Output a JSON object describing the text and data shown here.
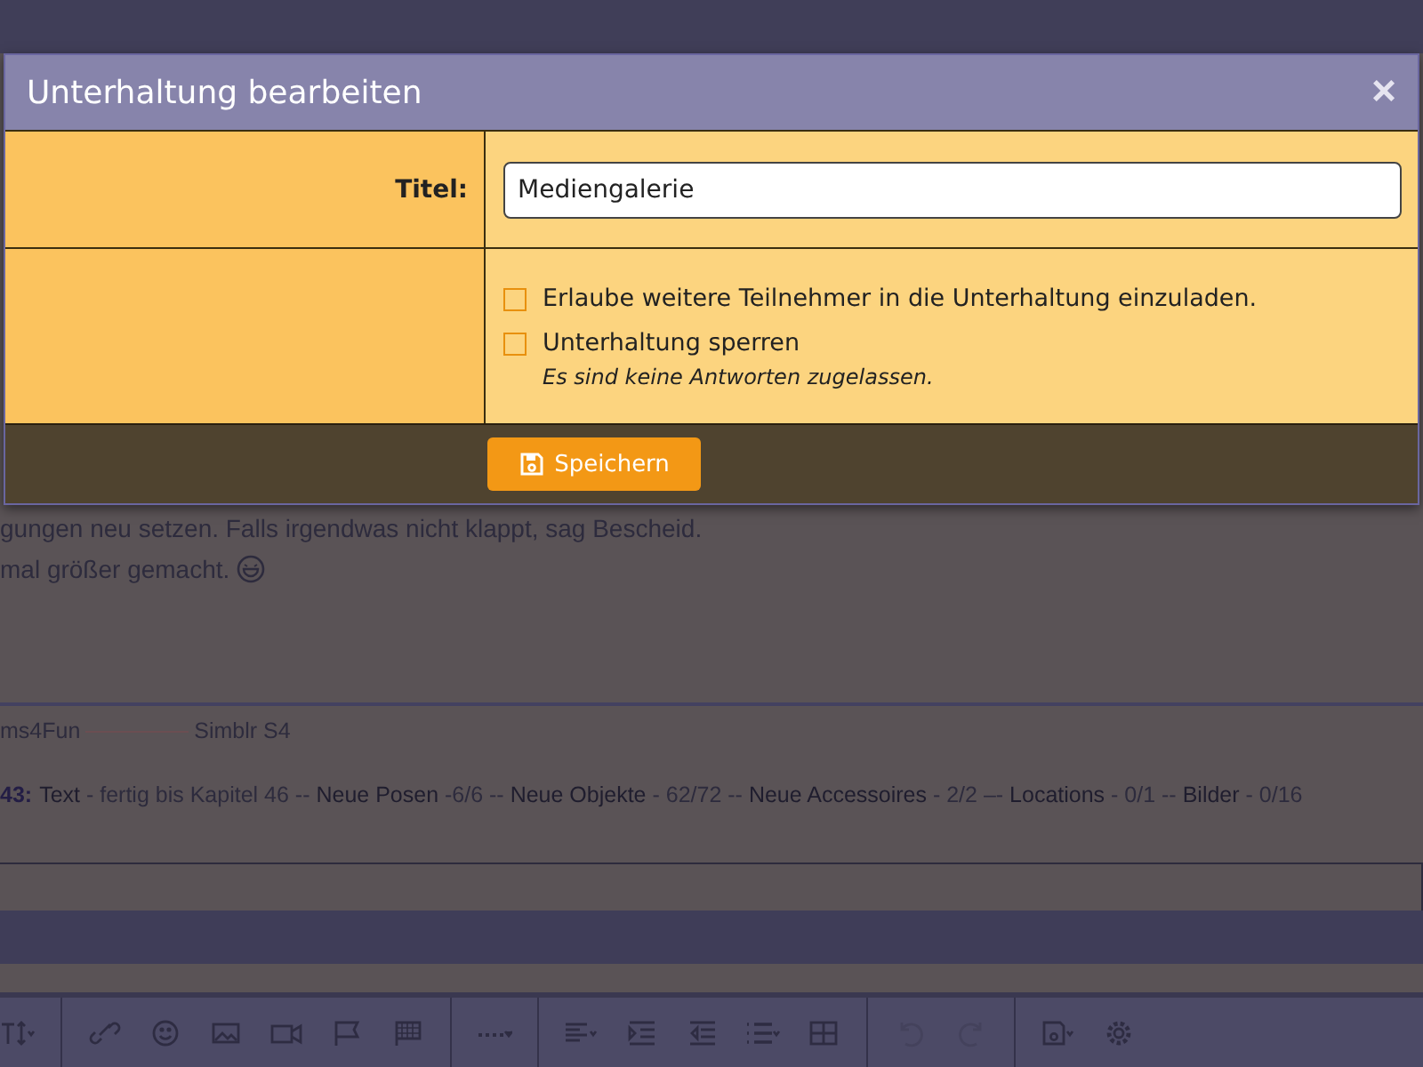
{
  "background": {
    "message_lines": [
      "gungen neu setzen. Falls irgendwas nicht klappt, sag Bescheid.",
      "mal größer gemacht."
    ],
    "signature_links": [
      "ms4Fun",
      "Simblr S4"
    ],
    "signature_label": "43:",
    "signature_text": "**Text** - fertig bis Kapitel 46 -- **Neue Posen** -6/6 -- **Neue Objekte** - 62/72 -- **Neue Accessoires** - 2/2 –- **Locations** - 0/1 -- **Bilder** - 0/16",
    "toolbar": [
      {
        "kind": "text-size",
        "disabled": false
      },
      {
        "kind": "link",
        "disabled": false
      },
      {
        "kind": "smiley",
        "disabled": false
      },
      {
        "kind": "image",
        "disabled": false
      },
      {
        "kind": "video",
        "disabled": false
      },
      {
        "kind": "flag",
        "disabled": false
      },
      {
        "kind": "checkered-flag",
        "disabled": false
      },
      {
        "kind": "more",
        "disabled": false
      },
      {
        "kind": "align",
        "disabled": false
      },
      {
        "kind": "indent",
        "disabled": false
      },
      {
        "kind": "outdent",
        "disabled": false
      },
      {
        "kind": "list",
        "disabled": false
      },
      {
        "kind": "table",
        "disabled": false
      },
      {
        "kind": "undo",
        "disabled": true
      },
      {
        "kind": "redo",
        "disabled": true
      },
      {
        "kind": "save",
        "disabled": false
      },
      {
        "kind": "gear",
        "disabled": false
      }
    ]
  },
  "dialog": {
    "title": "Unterhaltung bearbeiten",
    "close": "×",
    "title_field": {
      "label": "Titel:",
      "value": "Mediengalerie"
    },
    "options": [
      {
        "label": "Erlaube weitere Teilnehmer in die Unterhaltung einzuladen.",
        "checked": false
      },
      {
        "label": "Unterhaltung sperren",
        "hint": "Es sind keine Antworten zugelassen.",
        "checked": false
      }
    ],
    "save_button": "Speichern"
  }
}
